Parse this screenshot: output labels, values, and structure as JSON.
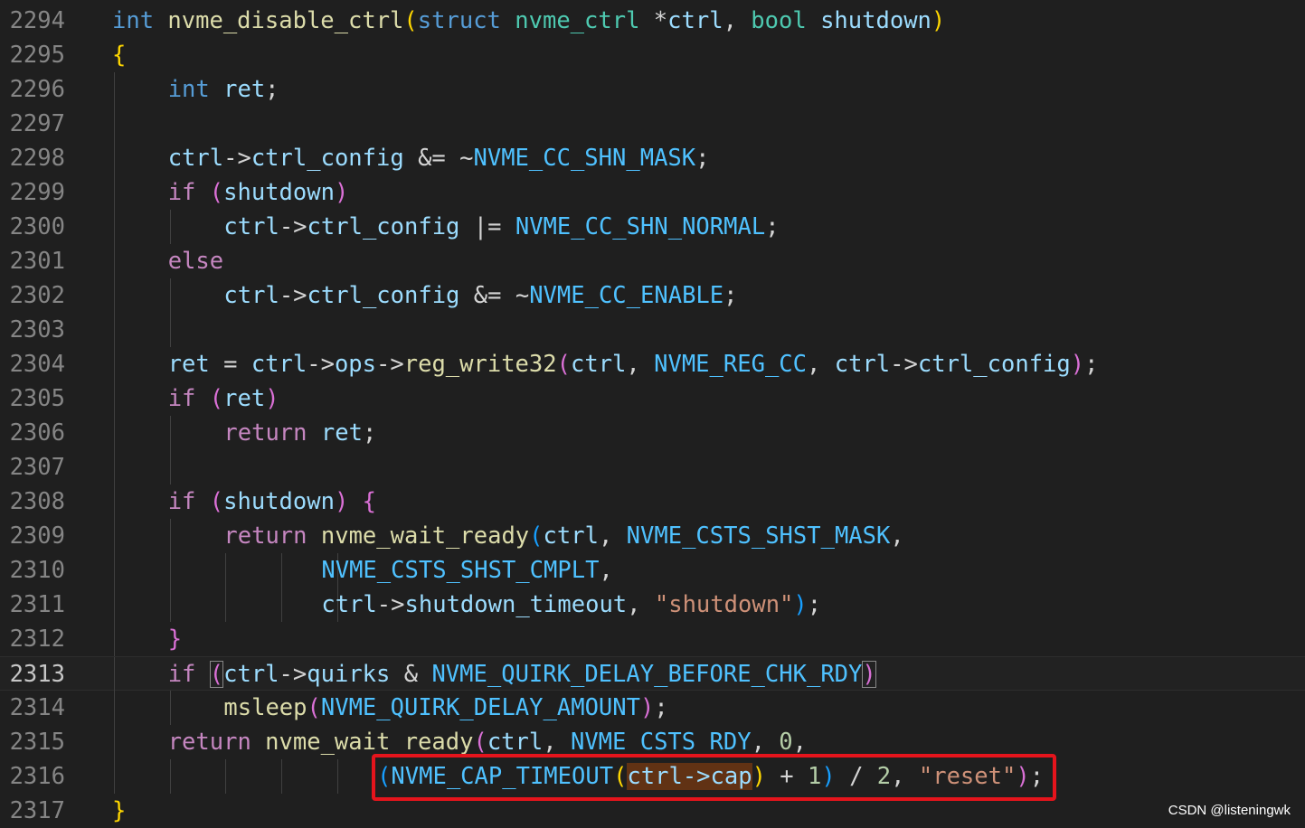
{
  "editor": {
    "lines": [
      {
        "no": "2294",
        "indent": 0,
        "tokens": [
          [
            "int",
            "t-kw"
          ],
          [
            " "
          ],
          [
            "nvme_disable_ctrl",
            "t-fn"
          ],
          [
            "(",
            "t-br1"
          ],
          [
            "struct",
            "t-kw"
          ],
          [
            " "
          ],
          [
            "nvme_ctrl",
            "t-type"
          ],
          [
            " *",
            "t-op"
          ],
          [
            "ctrl",
            "t-var"
          ],
          [
            ", ",
            "t-op"
          ],
          [
            "bool",
            "t-type"
          ],
          [
            " "
          ],
          [
            "shutdown",
            "t-var"
          ],
          [
            ")",
            "t-br1"
          ]
        ]
      },
      {
        "no": "2295",
        "indent": 0,
        "tokens": [
          [
            "{",
            "t-br1"
          ]
        ]
      },
      {
        "no": "2296",
        "indent": 1,
        "tokens": [
          [
            "int",
            "t-kw"
          ],
          [
            " "
          ],
          [
            "ret",
            "t-var"
          ],
          [
            ";",
            "t-op"
          ]
        ]
      },
      {
        "no": "2297",
        "indent": 1,
        "tokens": []
      },
      {
        "no": "2298",
        "indent": 1,
        "tokens": [
          [
            "ctrl",
            "t-var"
          ],
          [
            "->",
            "t-op"
          ],
          [
            "ctrl_config",
            "t-var"
          ],
          [
            " &= ~",
            "t-op"
          ],
          [
            "NVME_CC_SHN_MASK",
            "t-macro"
          ],
          [
            ";",
            "t-op"
          ]
        ]
      },
      {
        "no": "2299",
        "indent": 1,
        "tokens": [
          [
            "if",
            "t-ctl"
          ],
          [
            " "
          ],
          [
            "(",
            "t-br2"
          ],
          [
            "shutdown",
            "t-var"
          ],
          [
            ")",
            "t-br2"
          ]
        ]
      },
      {
        "no": "2300",
        "indent": 2,
        "tokens": [
          [
            "ctrl",
            "t-var"
          ],
          [
            "->",
            "t-op"
          ],
          [
            "ctrl_config",
            "t-var"
          ],
          [
            " |= ",
            "t-op"
          ],
          [
            "NVME_CC_SHN_NORMAL",
            "t-macro"
          ],
          [
            ";",
            "t-op"
          ]
        ]
      },
      {
        "no": "2301",
        "indent": 1,
        "tokens": [
          [
            "else",
            "t-ctl"
          ]
        ]
      },
      {
        "no": "2302",
        "indent": 2,
        "tokens": [
          [
            "ctrl",
            "t-var"
          ],
          [
            "->",
            "t-op"
          ],
          [
            "ctrl_config",
            "t-var"
          ],
          [
            " &= ~",
            "t-op"
          ],
          [
            "NVME_CC_ENABLE",
            "t-macro"
          ],
          [
            ";",
            "t-op"
          ]
        ]
      },
      {
        "no": "2303",
        "indent": 2,
        "tokens": []
      },
      {
        "no": "2304",
        "indent": 1,
        "tokens": [
          [
            "ret",
            "t-var"
          ],
          [
            " = ",
            "t-op"
          ],
          [
            "ctrl",
            "t-var"
          ],
          [
            "->",
            "t-op"
          ],
          [
            "ops",
            "t-var"
          ],
          [
            "->",
            "t-op"
          ],
          [
            "reg_write32",
            "t-fn"
          ],
          [
            "(",
            "t-br2"
          ],
          [
            "ctrl",
            "t-var"
          ],
          [
            ", ",
            "t-op"
          ],
          [
            "NVME_REG_CC",
            "t-macro"
          ],
          [
            ", ",
            "t-op"
          ],
          [
            "ctrl",
            "t-var"
          ],
          [
            "->",
            "t-op"
          ],
          [
            "ctrl_config",
            "t-var"
          ],
          [
            ")",
            "t-br2"
          ],
          [
            ";",
            "t-op"
          ]
        ]
      },
      {
        "no": "2305",
        "indent": 1,
        "tokens": [
          [
            "if",
            "t-ctl"
          ],
          [
            " "
          ],
          [
            "(",
            "t-br2"
          ],
          [
            "ret",
            "t-var"
          ],
          [
            ")",
            "t-br2"
          ]
        ]
      },
      {
        "no": "2306",
        "indent": 2,
        "tokens": [
          [
            "return",
            "t-ctl"
          ],
          [
            " "
          ],
          [
            "ret",
            "t-var"
          ],
          [
            ";",
            "t-op"
          ]
        ]
      },
      {
        "no": "2307",
        "indent": 2,
        "tokens": []
      },
      {
        "no": "2308",
        "indent": 1,
        "tokens": [
          [
            "if",
            "t-ctl"
          ],
          [
            " "
          ],
          [
            "(",
            "t-br2"
          ],
          [
            "shutdown",
            "t-var"
          ],
          [
            ")",
            "t-br2"
          ],
          [
            " "
          ],
          [
            "{",
            "t-br2"
          ]
        ]
      },
      {
        "no": "2309",
        "indent": 2,
        "tokens": [
          [
            "return",
            "t-ctl"
          ],
          [
            " "
          ],
          [
            "nvme_wait_ready",
            "t-fn"
          ],
          [
            "(",
            "t-br3"
          ],
          [
            "ctrl",
            "t-var"
          ],
          [
            ", ",
            "t-op"
          ],
          [
            "NVME_CSTS_SHST_MASK",
            "t-macro"
          ],
          [
            ",",
            "t-op"
          ]
        ]
      },
      {
        "no": "2310",
        "indent": 2,
        "guides": 5,
        "pad": 15,
        "tokens": [
          [
            "NVME_CSTS_SHST_CMPLT",
            "t-macro"
          ],
          [
            ",",
            "t-op"
          ]
        ]
      },
      {
        "no": "2311",
        "indent": 2,
        "guides": 5,
        "pad": 15,
        "tokens": [
          [
            "ctrl",
            "t-var"
          ],
          [
            "->",
            "t-op"
          ],
          [
            "shutdown_timeout",
            "t-var"
          ],
          [
            ", ",
            "t-op"
          ],
          [
            "\"shutdown\"",
            "t-str"
          ],
          [
            ")",
            "t-br3"
          ],
          [
            ";",
            "t-op"
          ]
        ]
      },
      {
        "no": "2312",
        "indent": 1,
        "tokens": [
          [
            "}",
            "t-br2"
          ]
        ]
      },
      {
        "no": "2313",
        "indent": 1,
        "current": true,
        "tokens": [
          [
            "if",
            "t-ctl"
          ],
          [
            " "
          ],
          [
            "(",
            "t-br2 t-match"
          ],
          [
            "ctrl",
            "t-var"
          ],
          [
            "->",
            "t-op"
          ],
          [
            "quirks",
            "t-var"
          ],
          [
            " & ",
            "t-op"
          ],
          [
            "NVME_QUIRK_DELAY_BEFORE_CHK_RDY",
            "t-macro"
          ],
          [
            ")",
            "t-br2 t-match"
          ]
        ]
      },
      {
        "no": "2314",
        "indent": 2,
        "tokens": [
          [
            "msleep",
            "t-fn"
          ],
          [
            "(",
            "t-br2"
          ],
          [
            "NVME_QUIRK_DELAY_AMOUNT",
            "t-macro"
          ],
          [
            ")",
            "t-br2"
          ],
          [
            ";",
            "t-op"
          ]
        ]
      },
      {
        "no": "2315",
        "indent": 1,
        "tokens": [
          [
            "return",
            "t-ctl"
          ],
          [
            " "
          ],
          [
            "nvme_wait_ready",
            "t-fn"
          ],
          [
            "(",
            "t-br2"
          ],
          [
            "ctrl",
            "t-var"
          ],
          [
            ", ",
            "t-op"
          ],
          [
            "NVME_CSTS_RDY",
            "t-macro"
          ],
          [
            ", ",
            "t-op"
          ],
          [
            "0",
            "t-num"
          ],
          [
            ",",
            "t-op"
          ]
        ]
      },
      {
        "no": "2316",
        "indent": 1,
        "guides": 5,
        "pad": 19,
        "tokens": [
          [
            "(",
            "t-br3"
          ],
          [
            "NVME_CAP_TIMEOUT",
            "t-macro"
          ],
          [
            "(",
            "t-br1"
          ],
          [
            "ctrl->cap",
            "t-var t-hl"
          ],
          [
            ")",
            "t-br1"
          ],
          [
            " + ",
            "t-op"
          ],
          [
            "1",
            "t-num"
          ],
          [
            ")",
            "t-br3"
          ],
          [
            " / ",
            "t-op"
          ],
          [
            "2",
            "t-num"
          ],
          [
            ", ",
            "t-op"
          ],
          [
            "\"reset\"",
            "t-str"
          ],
          [
            ")",
            "t-br2"
          ],
          [
            ";",
            "t-op"
          ]
        ]
      },
      {
        "no": "2317",
        "indent": 0,
        "tokens": [
          [
            "}",
            "t-br1"
          ]
        ]
      }
    ]
  },
  "annotation": {
    "color": "#e5141c"
  },
  "watermark": {
    "text": "CSDN @listeningwk"
  },
  "theme": {
    "background": "#1f1f1f",
    "line_number": "#858585"
  }
}
